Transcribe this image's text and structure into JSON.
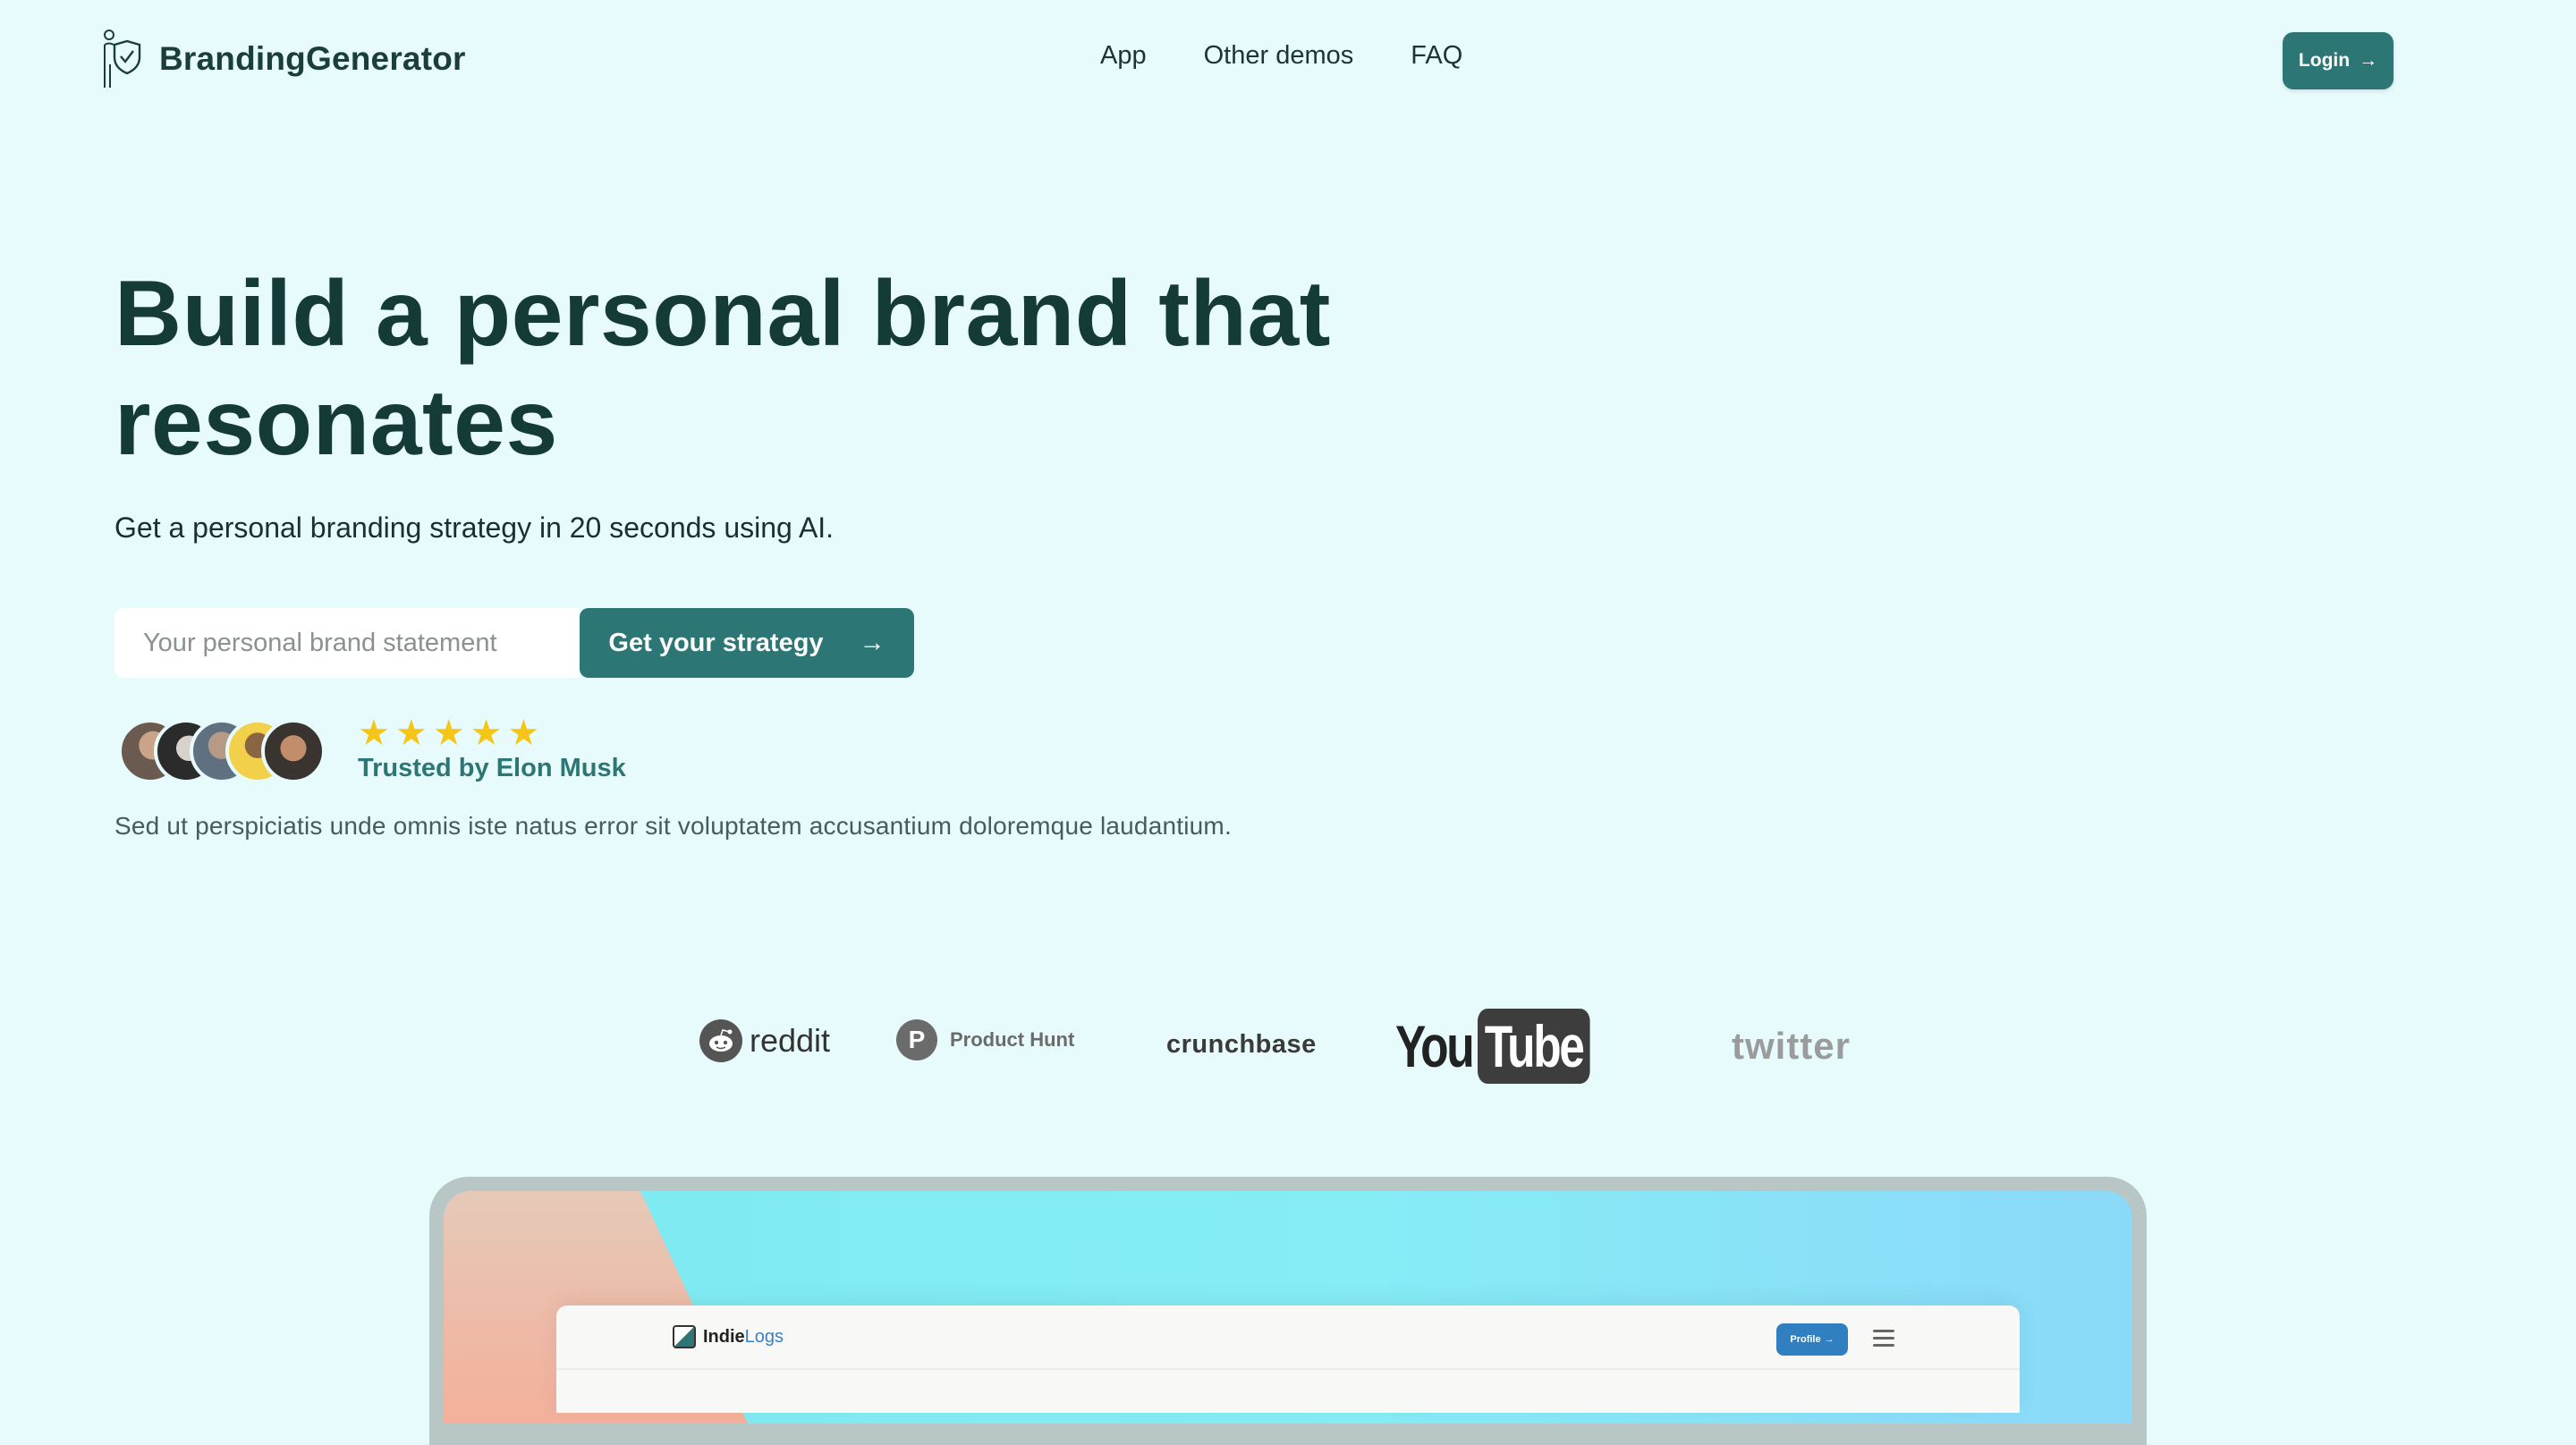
{
  "header": {
    "brand_name": "BrandingGenerator",
    "nav": [
      "App",
      "Other demos",
      "FAQ"
    ],
    "login_label": "Login"
  },
  "hero": {
    "title": "Build a personal brand that resonates",
    "subtitle": "Get a personal branding strategy in 20 seconds using AI.",
    "input_placeholder": "Your personal brand statement",
    "cta_label": "Get your strategy",
    "rating_stars": 5,
    "trusted_text": "Trusted by Elon Musk",
    "description": "Sed ut perspiciatis unde omnis iste natus error sit voluptatem accusantium doloremque laudantium."
  },
  "logos": {
    "reddit": "reddit",
    "producthunt": "Product Hunt",
    "producthunt_mark": "P",
    "crunchbase": "crunchbase",
    "youtube_you": "You",
    "youtube_tube": "Tube",
    "twitter": "twitter"
  },
  "preview": {
    "logo_prefix": "Indie",
    "logo_suffix": "Logs",
    "profile_label": "Profile"
  },
  "colors": {
    "background": "#e7fbfc",
    "accent": "#2c7775",
    "heading": "#153b38",
    "stars": "#f5c518"
  }
}
